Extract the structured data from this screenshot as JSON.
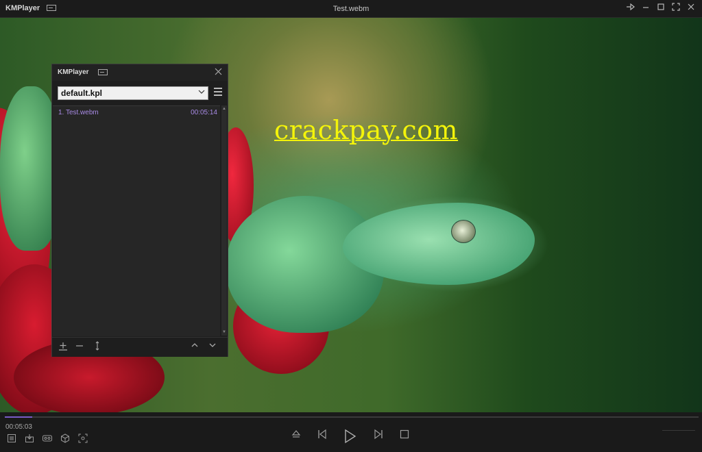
{
  "window": {
    "app_name": "KMPlayer",
    "title": "Test.webm",
    "buttons": [
      "pin-icon",
      "minimize-icon",
      "maximize-icon",
      "fullscreen-icon",
      "close-icon"
    ]
  },
  "video": {
    "watermark": "crackpay.com"
  },
  "playlist": {
    "title": "KMPlayer",
    "selected_list": "default.kpl",
    "items": [
      {
        "name": "1. Test.webm",
        "duration": "00:05:14"
      }
    ],
    "footer_buttons": [
      "add-icon",
      "remove-icon",
      "sort-icon",
      "move-up-icon",
      "move-down-icon"
    ]
  },
  "player": {
    "current_time": "00:05:03",
    "progress": 0.04,
    "accent_color": "#7a5cc8"
  }
}
